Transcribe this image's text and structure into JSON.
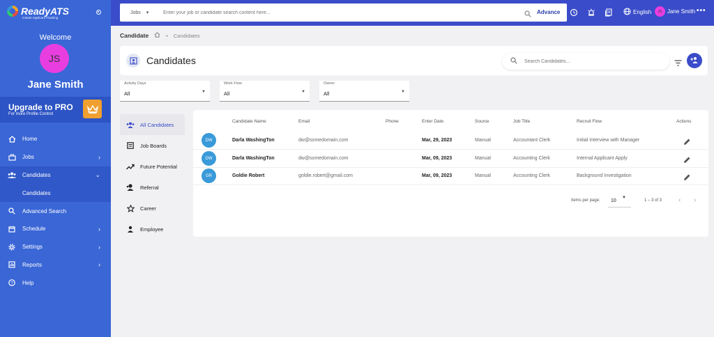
{
  "brand": {
    "name": "ReadyATS",
    "tagline": "Instant Applicant Tracking"
  },
  "sidebar": {
    "welcome": "Welcome",
    "initials": "JS",
    "user_name": "Jane Smith",
    "upgrade_title": "Upgrade to PRO",
    "upgrade_sub": "For more Profile Control",
    "items": [
      {
        "label": "Home"
      },
      {
        "label": "Jobs"
      },
      {
        "label": "Candidates"
      },
      {
        "label": "Candidates"
      },
      {
        "label": "Advanced Search"
      },
      {
        "label": "Schedule"
      },
      {
        "label": "Settings"
      },
      {
        "label": "Reports"
      },
      {
        "label": "Help"
      }
    ]
  },
  "topbar": {
    "search_scope": "Jobs",
    "search_placeholder": "Enter your job or candidate search content here...",
    "advance_label": "Advance",
    "language": "English",
    "user_initials": "JS",
    "user_name": "Jane Smith"
  },
  "breadcrumb": {
    "title": "Candidate",
    "item": "Candidates"
  },
  "header": {
    "title": "Candidates",
    "search_placeholder": "Search Candidates..."
  },
  "filters": [
    {
      "label": "Activity Days",
      "value": "All"
    },
    {
      "label": "Work Flow",
      "value": "All"
    },
    {
      "label": "Owner",
      "value": "All"
    }
  ],
  "categories": [
    {
      "label": "All Candidates"
    },
    {
      "label": "Job Boards"
    },
    {
      "label": "Future Potential"
    },
    {
      "label": "Referral"
    },
    {
      "label": "Career"
    },
    {
      "label": "Employee"
    }
  ],
  "table": {
    "headers": {
      "name": "Candidate Name",
      "email": "Email",
      "phone": "Phone",
      "enter_date": "Enter Date",
      "source": "Source",
      "job_title": "Job Title",
      "recruit_flow": "Recruit Flow",
      "actions": "Actions"
    },
    "rows": [
      {
        "initials": "DW",
        "name": "Darla WashingTon",
        "email": "dw@somedomain.com",
        "phone": "",
        "enter_date": "Mar, 29, 2023",
        "source": "Manual",
        "job_title": "Accountant Clerk",
        "recruit_flow": "Initial Interview with Manager"
      },
      {
        "initials": "DW",
        "name": "Darla WashingTon",
        "email": "dw@somedomain.com",
        "phone": "",
        "enter_date": "Mar, 09, 2023",
        "source": "Manual",
        "job_title": "Accounting Clerk",
        "recruit_flow": "Internal Applicant Apply"
      },
      {
        "initials": "GR",
        "name": "Goldie Robert",
        "email": "goldie.robert@gmail.com",
        "phone": "",
        "enter_date": "Mar, 09, 2023",
        "source": "Manual",
        "job_title": "Accounting Clerk",
        "recruit_flow": "Background Investigation"
      }
    ],
    "pagination": {
      "items_per_page_label": "Items per page:",
      "items_per_page": "10",
      "range": "1 – 3 of 3"
    }
  },
  "colors": {
    "sidebar": "#3a66d6",
    "topbar": "#3a4cc9",
    "avatar_pink": "#e83ee0",
    "row_avatar": "#3a9ad9",
    "upgrade_crown": "#f0a030"
  }
}
